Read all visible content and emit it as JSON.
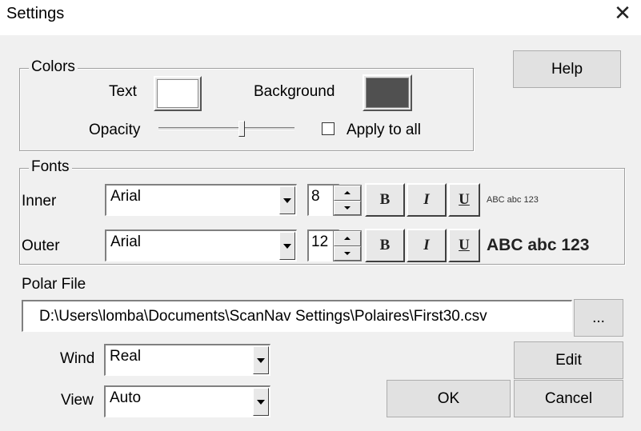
{
  "window": {
    "title": "Settings",
    "close_glyph": "✕"
  },
  "colors": {
    "legend": "Colors",
    "text_label": "Text",
    "background_label": "Background",
    "text_swatch_color": "#ffffff",
    "background_swatch_color": "#505050",
    "opacity_label": "Opacity",
    "opacity_value": 0.62,
    "apply_to_all_label": "Apply to all",
    "apply_to_all_checked": false
  },
  "help_label": "Help",
  "fonts": {
    "legend": "Fonts",
    "bold_glyph": "B",
    "italic_glyph": "I",
    "underline_glyph": "U",
    "inner": {
      "label": "Inner",
      "font": "Arial",
      "size": "8",
      "preview": "ABC abc 123"
    },
    "outer": {
      "label": "Outer",
      "font": "Arial",
      "size": "12",
      "preview": "ABC abc 123"
    }
  },
  "polar": {
    "label": "Polar File",
    "path": "D:\\Users\\lomba\\Documents\\ScanNav Settings\\Polaires\\First30.csv",
    "browse_label": "..."
  },
  "wind": {
    "label": "Wind",
    "value": "Real"
  },
  "view": {
    "label": "View",
    "value": "Auto"
  },
  "buttons": {
    "edit": "Edit",
    "ok": "OK",
    "cancel": "Cancel"
  }
}
